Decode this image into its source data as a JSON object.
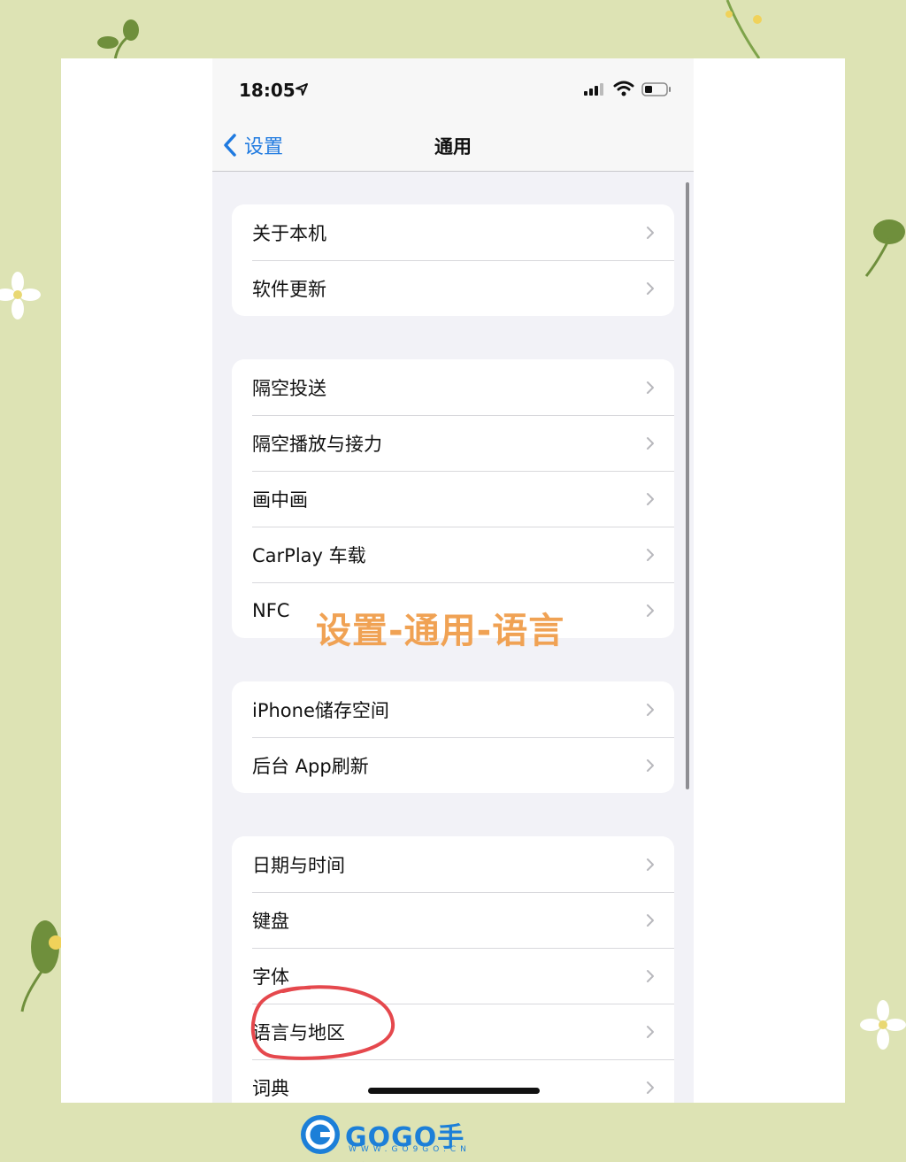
{
  "status_bar": {
    "time": "18:05"
  },
  "nav": {
    "back_label": "设置",
    "title": "通用"
  },
  "groups": [
    {
      "items": [
        "关于本机",
        "软件更新"
      ]
    },
    {
      "items": [
        "隔空投送",
        "隔空播放与接力",
        "画中画",
        "CarPlay 车载",
        "NFC"
      ]
    },
    {
      "items": [
        "iPhone储存空间",
        "后台 App刷新"
      ]
    },
    {
      "items": [
        "日期与时间",
        "键盘",
        "字体",
        "语言与地区",
        "词典"
      ]
    }
  ],
  "annotation": {
    "overlay_text": "设置-通用-语言",
    "highlighted_item": "语言与地区"
  },
  "watermark": {
    "brand": "GOGO手游网",
    "url": "WWW.GO9GO.CN"
  },
  "colors": {
    "accent": "#1f7ae0",
    "overlay": "#f0a254",
    "highlight_circle": "#e5484d",
    "background": "#dde3b4"
  }
}
